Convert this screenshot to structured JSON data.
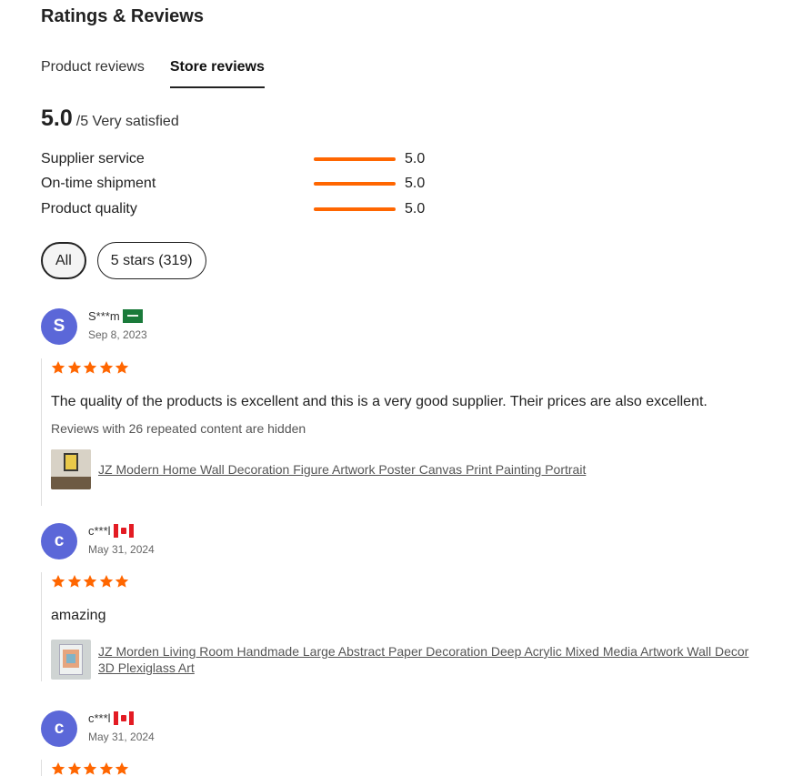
{
  "heading": "Ratings & Reviews",
  "tabs": [
    {
      "label": "Product reviews",
      "active": false
    },
    {
      "label": "Store reviews",
      "active": true
    }
  ],
  "summary": {
    "score": "5.0",
    "scale_text": "/5 Very satisfied"
  },
  "metrics": [
    {
      "label": "Supplier service",
      "value": "5.0",
      "fill_fraction": 1.0
    },
    {
      "label": "On-time shipment",
      "value": "5.0",
      "fill_fraction": 1.0
    },
    {
      "label": "Product quality",
      "value": "5.0",
      "fill_fraction": 1.0
    }
  ],
  "filters": [
    {
      "label": "All",
      "selected": true
    },
    {
      "label": "5 stars (319)",
      "selected": false
    }
  ],
  "star_color": "#ff6600",
  "accent_color": "#ff6600",
  "avatar_color": "#5b67d8",
  "reviews": [
    {
      "avatar_letter": "S",
      "name": "S***m",
      "flag_icon": "saudi-arabia-flag-icon",
      "date": "Sep 8, 2023",
      "rating": 5,
      "text": "The quality of the products is excellent and this is a very good supplier. Their prices are also excellent.",
      "hidden_note": "Reviews with 26 repeated content are hidden",
      "product_title": "JZ Modern Home Wall Decoration Figure Artwork Poster Canvas Print Painting Portrait"
    },
    {
      "avatar_letter": "c",
      "name": "c***l",
      "flag_icon": "canada-flag-icon",
      "date": "May 31, 2024",
      "rating": 5,
      "text": "amazing",
      "product_title": "JZ Morden Living Room Handmade Large Abstract Paper Decoration Deep Acrylic Mixed Media Artwork Wall Decor 3D Plexiglass Art"
    },
    {
      "avatar_letter": "c",
      "name": "c***l",
      "flag_icon": "canada-flag-icon",
      "date": "May 31, 2024",
      "rating": 5
    }
  ]
}
